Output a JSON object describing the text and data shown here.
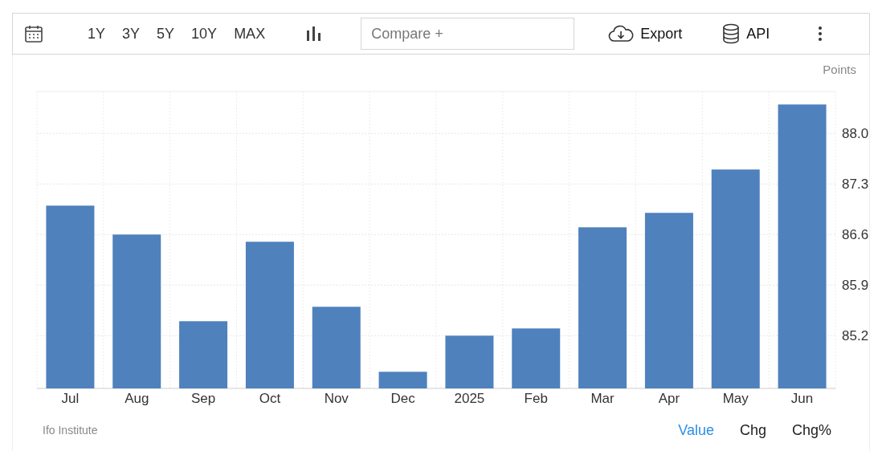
{
  "toolbar": {
    "ranges": [
      {
        "label": "1Y"
      },
      {
        "label": "3Y"
      },
      {
        "label": "5Y"
      },
      {
        "label": "10Y"
      },
      {
        "label": "MAX"
      }
    ],
    "compare": {
      "placeholder": "Compare +"
    },
    "actions": [
      {
        "kind": "export",
        "label": "Export"
      },
      {
        "kind": "api",
        "label": "API"
      }
    ]
  },
  "unit": "Points",
  "chart_data": {
    "type": "bar",
    "categories": [
      "Jul",
      "Aug",
      "Sep",
      "Oct",
      "Nov",
      "Dec",
      "2025",
      "Feb",
      "Mar",
      "Apr",
      "May",
      "Jun"
    ],
    "grid": true,
    "series": [
      {
        "color": "#4f81bd",
        "values": [
          87.0,
          86.6,
          85.4,
          86.5,
          85.6,
          84.7,
          85.2,
          85.3,
          86.7,
          86.9,
          87.5,
          88.4
        ]
      }
    ],
    "ylim": [
      84.47,
      88.58
    ],
    "yticks": [
      {
        "value": 85.2,
        "label": "85.2"
      },
      {
        "value": 85.9,
        "label": "85.9"
      },
      {
        "value": 86.6,
        "label": "86.6"
      },
      {
        "value": 87.3,
        "label": "87.3"
      },
      {
        "value": 88,
        "label": "88.0"
      }
    ]
  },
  "source": "Ifo Institute",
  "views": [
    {
      "label": "Value",
      "selected": true
    },
    {
      "label": "Chg",
      "selected": false
    },
    {
      "label": "Chg%",
      "selected": false
    }
  ]
}
